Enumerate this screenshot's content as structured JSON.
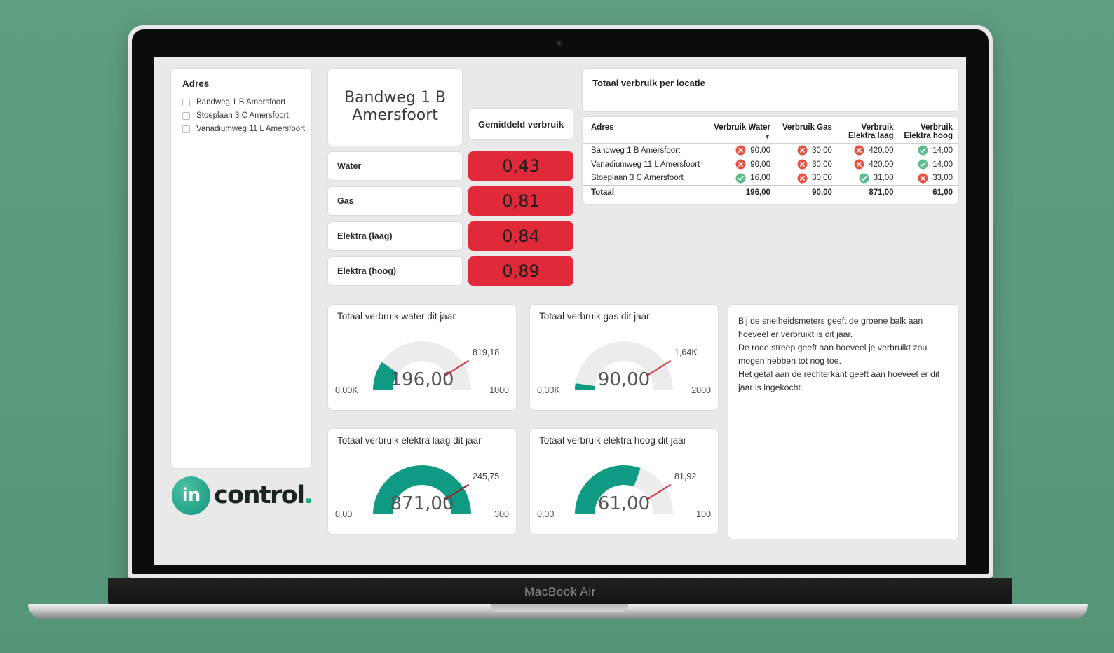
{
  "device": {
    "label": "MacBook Air"
  },
  "sidebar": {
    "title": "Adres",
    "items": [
      {
        "label": "Bandweg 1 B Amersfoort"
      },
      {
        "label": "Stoeplaan 3 C Amersfoort"
      },
      {
        "label": "Vanadiumweg 11 L Amersfoort"
      }
    ]
  },
  "brand": {
    "mark": "in",
    "word": "control",
    "dot": ".",
    "circle_color": "#22a98c",
    "word_color": "#1c2526"
  },
  "selected_address": {
    "title": "Bandweg 1 B\nAmersfoort"
  },
  "kpi": {
    "header": "Gemiddeld verbruik",
    "accent_red": "#e02a3a",
    "rows": [
      {
        "label": "Water",
        "value": "0,43"
      },
      {
        "label": "Gas",
        "value": "0,81"
      },
      {
        "label": "Elektra (laag)",
        "value": "0,84"
      },
      {
        "label": "Elektra (hoog)",
        "value": "0,89"
      }
    ]
  },
  "matrix": {
    "title": "Totaal verbruik per locatie",
    "columns": [
      {
        "label": "Adres",
        "line2": "",
        "sort": "desc-none"
      },
      {
        "label": "Verbruik Water",
        "line2": "",
        "sort": "desc"
      },
      {
        "label": "Verbruik Gas",
        "line2": "",
        "sort": ""
      },
      {
        "label": "Verbruik",
        "line2": "Elektra laag",
        "sort": ""
      },
      {
        "label": "Verbruik",
        "line2": "Elektra hoog",
        "sort": ""
      }
    ],
    "rows": [
      {
        "address": "Bandweg 1 B Amersfoort",
        "water": {
          "status": "bad",
          "value": "90,00"
        },
        "gas": {
          "status": "bad",
          "value": "30,00"
        },
        "elektra_laag": {
          "status": "bad",
          "value": "420,00"
        },
        "elektra_hoog": {
          "status": "good",
          "value": "14,00"
        }
      },
      {
        "address": "Vanadiumweg 11 L Amersfoort",
        "water": {
          "status": "bad",
          "value": "90,00"
        },
        "gas": {
          "status": "bad",
          "value": "30,00"
        },
        "elektra_laag": {
          "status": "bad",
          "value": "420,00"
        },
        "elektra_hoog": {
          "status": "good",
          "value": "14,00"
        }
      },
      {
        "address": "Stoeplaan 3 C Amersfoort",
        "water": {
          "status": "good",
          "value": "16,00"
        },
        "gas": {
          "status": "bad",
          "value": "30,00"
        },
        "elektra_laag": {
          "status": "good",
          "value": "31,00"
        },
        "elektra_hoog": {
          "status": "bad",
          "value": "33,00"
        }
      }
    ],
    "total": {
      "label": "Totaal",
      "water": "196,00",
      "gas": "90,00",
      "elektra_laag": "871,00",
      "elektra_hoog": "61,00"
    },
    "status_colors": {
      "bad": "#e8503f",
      "good": "#5bbd8e"
    }
  },
  "info": {
    "lines": [
      "Bij de snelheidsmeters geeft de groene balk aan hoeveel er verbruikt is dit jaar.",
      "De rode streep geeft aan hoeveel je verbruikt zou mogen hebben tot nog toe.",
      "Het getal aan de rechterkant geeft aan hoeveel er dit jaar is ingekocht."
    ]
  },
  "chart_data": [
    {
      "type": "gauge",
      "title": "Totaal verbruik water dit jaar",
      "value": 196.0,
      "value_label": "196,00",
      "min": 0,
      "max": 1000,
      "min_label": "0,00K",
      "max_label": "1000",
      "target": 819.18,
      "target_label": "819,18",
      "fill_color": "#0f9a83",
      "track_color": "#ececec",
      "target_color": "#d32f3a"
    },
    {
      "type": "gauge",
      "title": "Totaal verbruik gas dit jaar",
      "value": 90.0,
      "value_label": "90,00",
      "min": 0,
      "max": 2000,
      "min_label": "0,00K",
      "max_label": "2000",
      "target": 1640,
      "target_label": "1,64K",
      "fill_color": "#0f9a83",
      "track_color": "#ececec",
      "target_color": "#d32f3a"
    },
    {
      "type": "gauge",
      "title": "Totaal verbruik elektra laag dit jaar",
      "value": 871.0,
      "value_label": "871,00",
      "min": 0,
      "max": 300,
      "min_label": "0,00",
      "max_label": "300",
      "target": 245.75,
      "target_label": "245,75",
      "fill_color": "#0f9a83",
      "track_color": "#ececec",
      "target_color": "#a32029"
    },
    {
      "type": "gauge",
      "title": "Totaal verbruik elektra hoog dit jaar",
      "value": 61.0,
      "value_label": "61,00",
      "min": 0,
      "max": 100,
      "min_label": "0,00",
      "max_label": "100",
      "target": 81.92,
      "target_label": "81,92",
      "fill_color": "#0f9a83",
      "track_color": "#ececec",
      "target_color": "#d32f3a"
    }
  ]
}
